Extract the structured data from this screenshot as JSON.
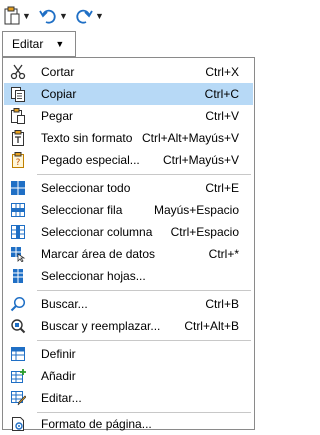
{
  "toolbar": {
    "paste_icon": "paste-icon",
    "undo_icon": "undo-icon",
    "redo_icon": "redo-icon"
  },
  "edit_menu_button": {
    "label": "Editar"
  },
  "menu": {
    "items": [
      {
        "label": "Cortar",
        "shortcut": "Ctrl+X",
        "icon": "scissors-icon"
      },
      {
        "label": "Copiar",
        "shortcut": "Ctrl+C",
        "icon": "copy-icon",
        "highlighted": true
      },
      {
        "label": "Pegar",
        "shortcut": "Ctrl+V",
        "icon": "paste-icon"
      },
      {
        "label": "Texto sin formato",
        "shortcut": "Ctrl+Alt+Mayús+V",
        "icon": "paste-unformatted-icon"
      },
      {
        "label": "Pegado especial...",
        "shortcut": "Ctrl+Mayús+V",
        "icon": "paste-special-icon"
      },
      {
        "label": "Seleccionar todo",
        "shortcut": "Ctrl+E",
        "icon": "select-all-icon"
      },
      {
        "label": "Seleccionar fila",
        "shortcut": "Mayús+Espacio",
        "icon": "select-row-icon"
      },
      {
        "label": "Seleccionar columna",
        "shortcut": "Ctrl+Espacio",
        "icon": "select-column-icon"
      },
      {
        "label": "Marcar área de datos",
        "shortcut": "Ctrl+*",
        "icon": "mark-data-area-icon"
      },
      {
        "label": "Seleccionar hojas...",
        "shortcut": "",
        "icon": "select-sheets-icon"
      },
      {
        "label": "Buscar...",
        "shortcut": "Ctrl+B",
        "icon": "find-icon"
      },
      {
        "label": "Buscar y reemplazar...",
        "shortcut": "Ctrl+Alt+B",
        "icon": "find-replace-icon"
      },
      {
        "label": "Definir",
        "shortcut": "",
        "icon": "define-icon"
      },
      {
        "label": "Añadir",
        "shortcut": "",
        "icon": "add-icon"
      },
      {
        "label": "Editar...",
        "shortcut": "",
        "icon": "edit-icon"
      },
      {
        "label": "Formato de página...",
        "shortcut": "",
        "icon": "page-format-icon"
      }
    ]
  }
}
